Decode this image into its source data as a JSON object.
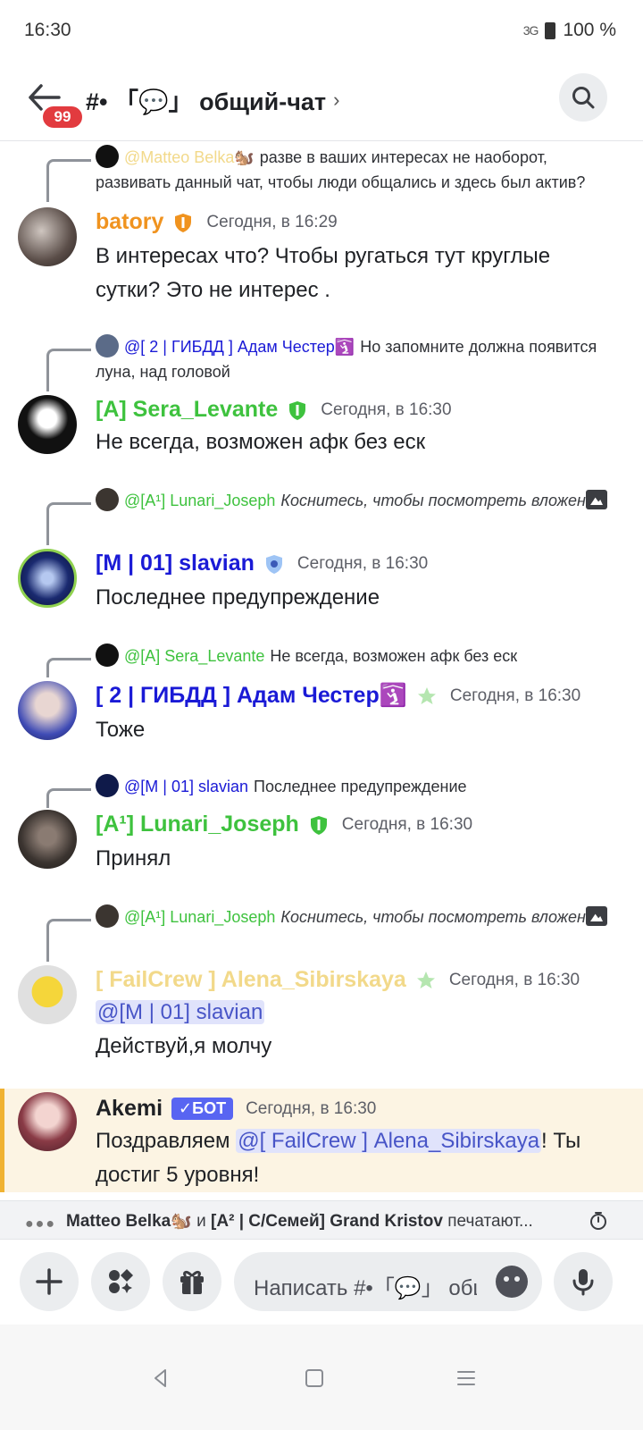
{
  "status_bar": {
    "time": "16:30",
    "signal": "3G",
    "battery": "100 %"
  },
  "header": {
    "unread_badge": "99",
    "channel_title": "#• 「💬」 общий-чат",
    "chevron": "›"
  },
  "messages": [
    {
      "reply": {
        "name": "@Matteo Belka🐿️",
        "text": "разве в ваших интересах не наоборот, развивать данный чат, чтобы люди общались и здесь был актив?",
        "name_color": "#f2d98a"
      },
      "author": "batory",
      "author_color": "#f0931f",
      "time": "Сегодня, в 16:29",
      "body": "В интересах что? Чтобы ругаться тут круглые сутки? Это не интерес ."
    },
    {
      "reply": {
        "name": "@[ 2 | ГИБДД ] Адам Честер🛐",
        "text": "Но запомните должна появится луна,  над головой",
        "name_color": "#1a1ad6"
      },
      "author": "[A] Sera_Levante",
      "author_color": "#3ec23e",
      "time": "Сегодня, в 16:30",
      "body": "Не всегда, возможен афк без еск"
    },
    {
      "reply": {
        "name": "@[A¹] Lunari_Joseph",
        "text": "Коснитесь, чтобы посмотреть вложение",
        "name_color": "#3ec23e"
      },
      "author": "[M | 01] slavian",
      "author_color": "#1a1ad6",
      "time": "Сегодня, в 16:30",
      "body": "Последнее предупреждение"
    },
    {
      "reply": {
        "name": "@[A] Sera_Levante",
        "text": "Не всегда, возможен афк без еск",
        "name_color": "#3ec23e"
      },
      "author": "[ 2 | ГИБДД ] Адам Честер🛐",
      "author_color": "#1a1ad6",
      "time": "Сегодня, в 16:30",
      "body": "Тоже"
    },
    {
      "reply": {
        "name": "@[M | 01] slavian",
        "text": "Последнее предупреждение",
        "name_color": "#1a1ad6"
      },
      "author": "[A¹] Lunari_Joseph",
      "author_color": "#3ec23e",
      "time": "Сегодня, в 16:30",
      "body": "Принял"
    },
    {
      "reply": {
        "name": "@[A¹] Lunari_Joseph",
        "text": "Коснитесь, чтобы посмотреть вложение",
        "name_color": "#3ec23e"
      },
      "author": "[ FailCrew ] Alena_Sibirskaya",
      "author_color": "#f2d98a",
      "time": "Сегодня, в 16:30",
      "mention": "@[M | 01] slavian",
      "body": "Действуй,я молчу"
    },
    {
      "author": "Akemi",
      "author_color": "#1f2125",
      "bot_tag": "✓БОТ",
      "time": "Сегодня, в 16:30",
      "body_prefix": "Поздравляем ",
      "mention": "@[ FailCrew ] Alena_Sibirskaya",
      "body_suffix": "! Ты достиг 5 уровня!"
    }
  ],
  "typing": {
    "names": "Matteo Belka🐿️",
    "and": "и",
    "names2": "[A² | С/Семей] Grand Kristov",
    "suffix": "печатают..."
  },
  "composer": {
    "placeholder": "Написать #•「💬」 общий-чат"
  },
  "colors": {
    "accent": "#5865f2",
    "badge": "#e23b3f",
    "highlight_bg": "#fcf4e3",
    "highlight_border": "#f0b232"
  },
  "icons": [
    "back-arrow-icon",
    "search-icon",
    "plus-icon",
    "apps-icon",
    "gift-icon",
    "emoji-icon",
    "mic-icon",
    "attachment-image-icon",
    "slowmode-timer-icon",
    "nav-back-icon",
    "nav-home-icon",
    "nav-recents-icon"
  ]
}
